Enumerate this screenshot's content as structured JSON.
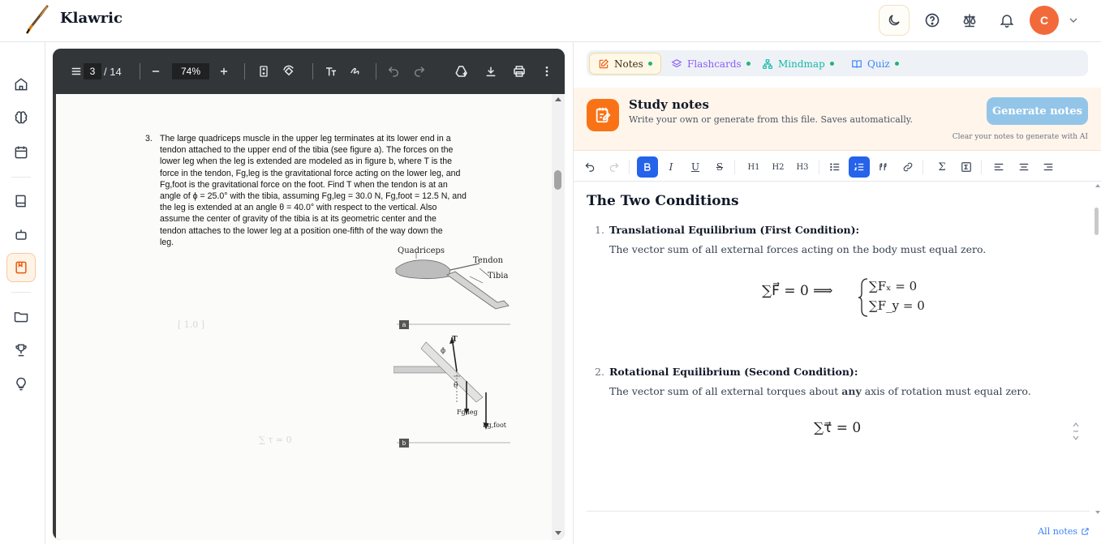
{
  "app": {
    "name": "Klawric"
  },
  "header": {
    "avatar_initial": "C"
  },
  "pdf": {
    "current_page": "3",
    "total_pages": "/ 14",
    "zoom": "74%",
    "problem_number": "3.",
    "problem_text": "The large quadriceps muscle in the upper leg terminates at its lower end in a\ntendon attached to the upper end of the tibia (see figure a). The forces on the\nlower leg when the leg is extended are modeled as in figure b, where T is the\nforce in the tendon, Fg,leg is the gravitational force acting on the lower leg, and\nFg,foot is the gravitational force on the foot. Find T when the tendon is at an\nangle of ϕ = 25.0° with the tibia, assuming Fg,leg = 30.0 N, Fg,foot = 12.5 N, and\nthe leg is extended at an angle θ = 40.0° with respect to the vertical. Also\nassume the center of gravity of the tibia is at its geometric center and the\ntendon attaches to the lower leg at a position one-fifth of the way down the\nleg.",
    "figure": {
      "quadriceps": "Quadriceps",
      "tendon": "Tendon",
      "tibia": "Tibia",
      "tag_a": "a",
      "tag_b": "b",
      "T": "T",
      "phi": "ϕ",
      "theta": "θ",
      "fgleg": "Fg,leg",
      "fgfoot": "Fg,foot"
    }
  },
  "tabs": [
    {
      "label": "Notes",
      "color": "#3b2a10"
    },
    {
      "label": "Flashcards",
      "color": "#8b5cf6"
    },
    {
      "label": "Mindmap",
      "color": "#14b8a6"
    },
    {
      "label": "Quiz",
      "color": "#3b82f6"
    }
  ],
  "study": {
    "title": "Study notes",
    "subtitle": "Write your own or generate from this file. Saves automatically.",
    "generate_label": "Generate notes",
    "hint": "Clear your notes to generate with AI"
  },
  "toolbar": {
    "h1": "H1",
    "h2": "H2",
    "h3": "H3",
    "italic": "I",
    "underline": "U",
    "strike": "S",
    "sigma": "Σ"
  },
  "notes": {
    "heading": "The Two Conditions",
    "items": [
      {
        "num": "1.",
        "title": "Translational Equilibrium (First Condition):",
        "body": "The vector sum of all external forces acting on the body must equal zero.",
        "eq_left": "∑F⃗ = 0 ⟹",
        "eq_r1": "∑Fₓ = 0",
        "eq_r2": "∑F_y = 0"
      },
      {
        "num": "2.",
        "title": "Rotational Equilibrium (Second Condition):",
        "body_pre": "The vector sum of all external torques about ",
        "body_bold": "any",
        "body_post": " axis of rotation must equal zero.",
        "eq": "∑τ⃗ = 0"
      }
    ]
  },
  "footer": {
    "all_notes": "All notes"
  }
}
